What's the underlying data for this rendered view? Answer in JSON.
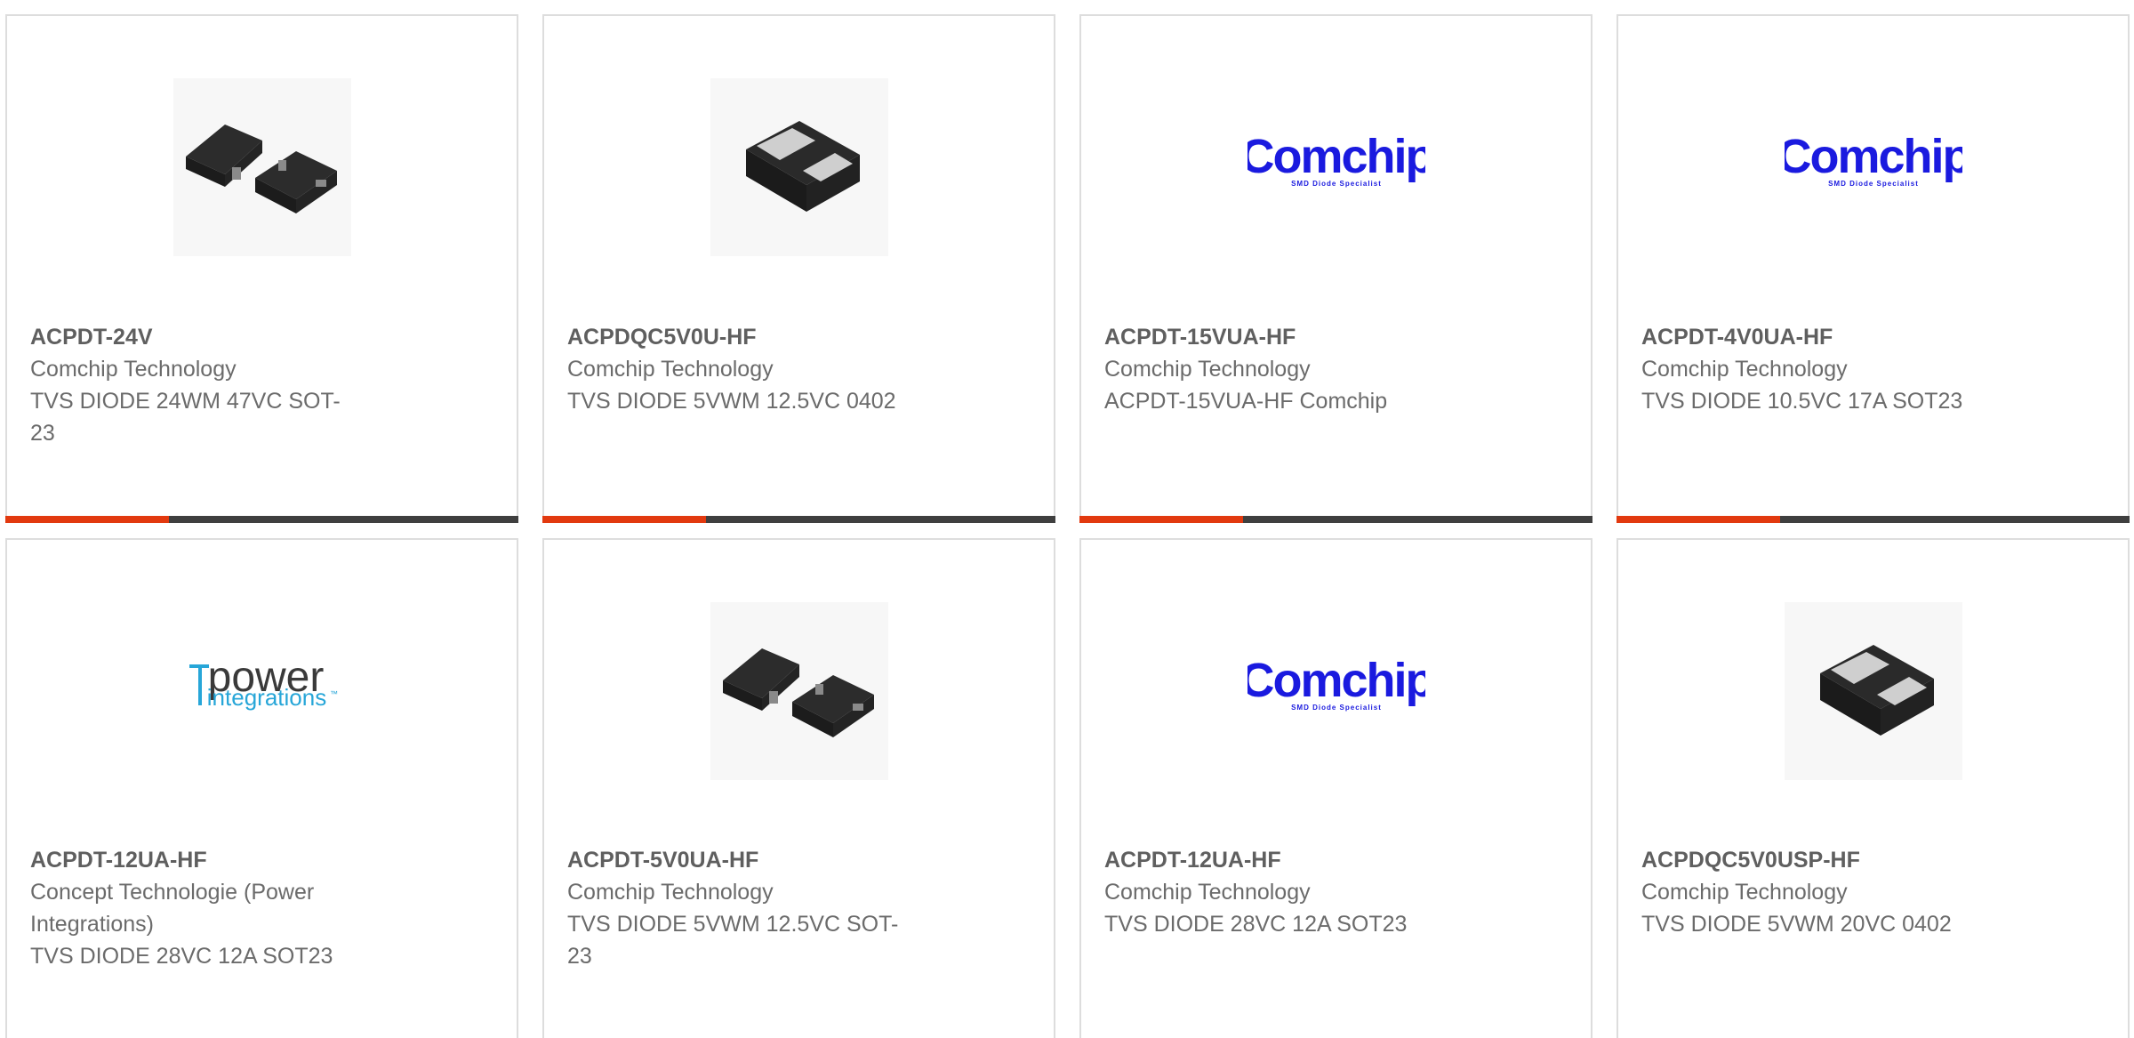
{
  "colors": {
    "accent": "#e2390f",
    "bar": "#3f3f3f",
    "border": "#dddddd",
    "comchip_blue": "#1a1adf"
  },
  "products": [
    {
      "part_number": "ACPDT-24V",
      "manufacturer": "Comchip Technology",
      "description": "TVS DIODE 24WM 47VC SOT-\n23",
      "image": "sot23-package-icon"
    },
    {
      "part_number": "ACPDQC5V0U-HF",
      "manufacturer": "Comchip Technology",
      "description": "TVS DIODE 5VWM 12.5VC 0402",
      "image": "0402-package-icon"
    },
    {
      "part_number": "ACPDT-15VUA-HF",
      "manufacturer": "Comchip Technology",
      "description": "ACPDT-15VUA-HF Comchip",
      "image": "comchip-logo"
    },
    {
      "part_number": "ACPDT-4V0UA-HF",
      "manufacturer": "Comchip Technology",
      "description": "TVS DIODE 10.5VC 17A SOT23",
      "image": "comchip-logo"
    },
    {
      "part_number": "ACPDT-12UA-HF",
      "manufacturer": "Concept Technologie (Power\nIntegrations)",
      "description": "TVS DIODE 28VC 12A SOT23",
      "image": "power-integrations-logo"
    },
    {
      "part_number": "ACPDT-5V0UA-HF",
      "manufacturer": "Comchip Technology",
      "description": "TVS DIODE 5VWM 12.5VC SOT-\n23",
      "image": "sot23-package-icon"
    },
    {
      "part_number": "ACPDT-12UA-HF",
      "manufacturer": "Comchip Technology",
      "description": "TVS DIODE 28VC 12A SOT23",
      "image": "comchip-logo"
    },
    {
      "part_number": "ACPDQC5V0USP-HF",
      "manufacturer": "Comchip Technology",
      "description": "TVS DIODE 5VWM 20VC 0402",
      "image": "0402-package-icon"
    }
  ],
  "logos": {
    "comchip_word": "Comchip",
    "comchip_tagline": "SMD Diode Specialist",
    "power_word": "power",
    "power_sub": "integrations",
    "power_tm": "™"
  }
}
